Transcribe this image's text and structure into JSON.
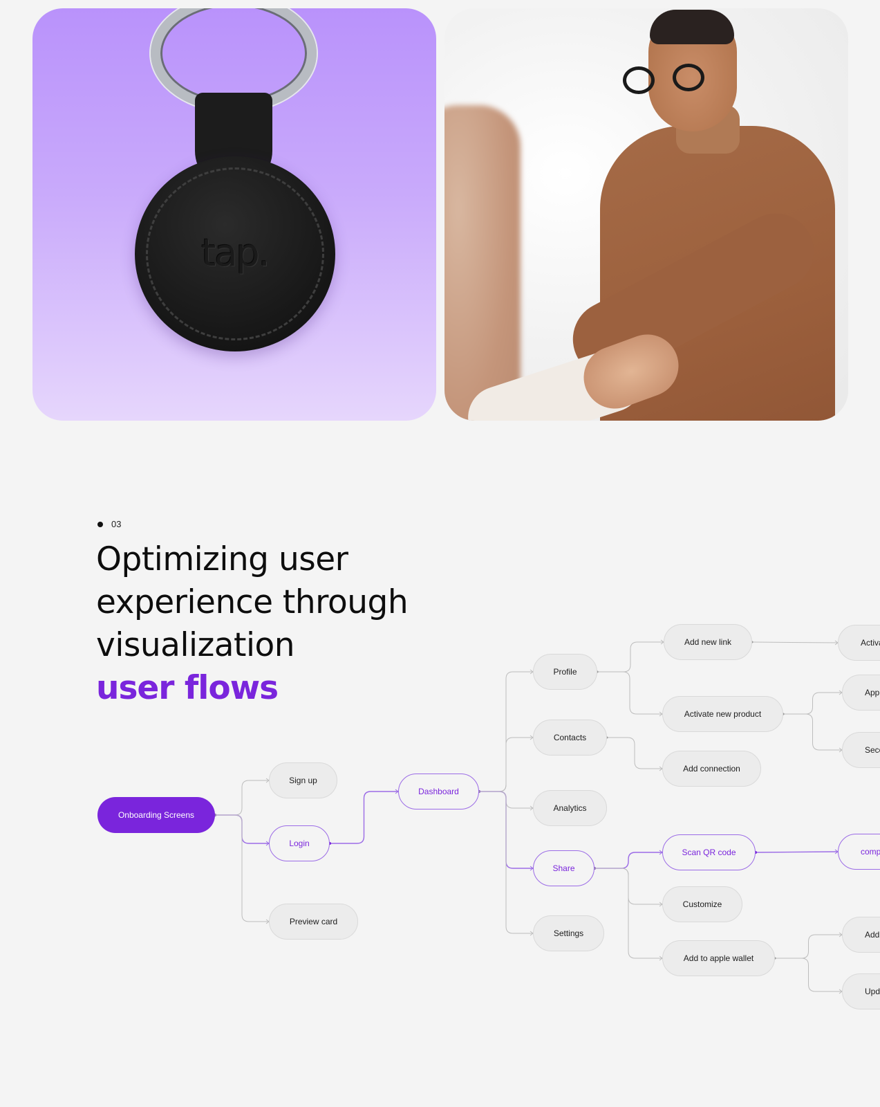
{
  "gallery": {
    "product_card": {
      "alt": "Black leather keychain tag with 'tap.' logo on purple background",
      "logo_text": "tap."
    },
    "photo_card": {
      "alt": "Smiling man in brown sweater shaking hands"
    }
  },
  "section": {
    "index": "03",
    "headline_lines": [
      "Optimizing user",
      "experience through",
      "visualization"
    ],
    "headline_accent": "user flows"
  },
  "colors": {
    "accent": "#7a25dc",
    "accent_line": "#9b6be6",
    "neutral_line": "#bdbdbd",
    "node_fill": "#ececec",
    "background": "#f4f4f4"
  },
  "flow": {
    "nodes": {
      "onboarding": {
        "label": "Onboarding Screens",
        "state": "primary"
      },
      "signup": {
        "label": "Sign up",
        "state": "default"
      },
      "login": {
        "label": "Login",
        "state": "active"
      },
      "preview": {
        "label": "Preview card",
        "state": "default"
      },
      "dashboard": {
        "label": "Dashboard",
        "state": "active"
      },
      "profile": {
        "label": "Profile",
        "state": "default"
      },
      "contacts": {
        "label": "Contacts",
        "state": "default"
      },
      "analytics": {
        "label": "Analytics",
        "state": "default"
      },
      "share": {
        "label": "Share",
        "state": "active"
      },
      "settings": {
        "label": "Settings",
        "state": "default"
      },
      "add_new_link": {
        "label": "Add new link",
        "state": "default"
      },
      "activate_new_product": {
        "label": "Activate new product",
        "state": "default"
      },
      "add_connection": {
        "label": "Add connection",
        "state": "default"
      },
      "scan_qr": {
        "label": "Scan QR code",
        "state": "active"
      },
      "customize": {
        "label": "Customize",
        "state": "default"
      },
      "add_apple_wallet": {
        "label": "Add to apple wallet",
        "state": "default"
      },
      "activa_clipped": {
        "label": "Activa",
        "state": "default"
      },
      "appli_clipped": {
        "label": "Appli",
        "state": "default"
      },
      "seco_clipped": {
        "label": "Seco",
        "state": "default"
      },
      "compl_clipped": {
        "label": "compl",
        "state": "active"
      },
      "add_clipped": {
        "label": "Add y",
        "state": "default"
      },
      "upda_clipped": {
        "label": "Upda",
        "state": "default"
      }
    },
    "edges": [
      [
        "onboarding",
        "signup",
        "neutral"
      ],
      [
        "onboarding",
        "login",
        "accent"
      ],
      [
        "onboarding",
        "preview",
        "neutral"
      ],
      [
        "login",
        "dashboard",
        "accent"
      ],
      [
        "dashboard",
        "profile",
        "neutral"
      ],
      [
        "dashboard",
        "contacts",
        "neutral"
      ],
      [
        "dashboard",
        "analytics",
        "neutral"
      ],
      [
        "dashboard",
        "share",
        "accent"
      ],
      [
        "dashboard",
        "settings",
        "neutral"
      ],
      [
        "profile",
        "add_new_link",
        "neutral"
      ],
      [
        "profile",
        "activate_new_product",
        "neutral"
      ],
      [
        "contacts",
        "add_connection",
        "neutral"
      ],
      [
        "add_new_link",
        "activa_clipped",
        "neutral"
      ],
      [
        "activate_new_product",
        "appli_clipped",
        "neutral"
      ],
      [
        "activate_new_product",
        "seco_clipped",
        "neutral"
      ],
      [
        "share",
        "scan_qr",
        "accent"
      ],
      [
        "share",
        "customize",
        "neutral"
      ],
      [
        "share",
        "add_apple_wallet",
        "neutral"
      ],
      [
        "scan_qr",
        "compl_clipped",
        "accent"
      ],
      [
        "add_apple_wallet",
        "add_clipped",
        "neutral"
      ],
      [
        "add_apple_wallet",
        "upda_clipped",
        "neutral"
      ]
    ]
  }
}
